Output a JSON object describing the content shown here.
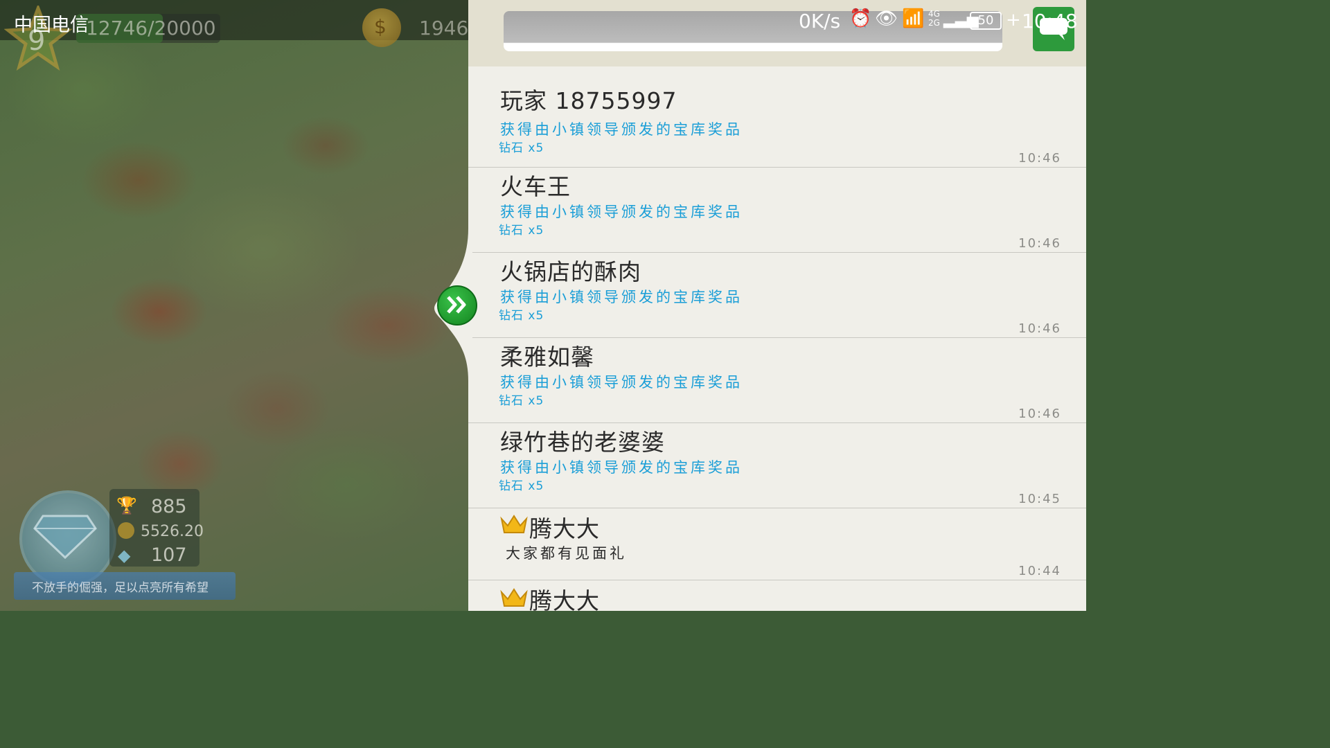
{
  "statusbar": {
    "carrier": "中国电信",
    "speed": "0K/s",
    "network": "4G 2G",
    "battery": "50",
    "time": "10:48"
  },
  "game": {
    "level": "9",
    "xp": "12746/20000",
    "coins_partial": "1946",
    "stats": {
      "trophies": "885",
      "gold": "5526.20",
      "gems": "107"
    },
    "ribbon_text": "不放手的倔强，足以点亮所有希望"
  },
  "feed": [
    {
      "name": "玩家 18755997",
      "desc": "获得由小镇领导颁发的宝库奖品",
      "reward": "钻石 x5",
      "time": "10:46"
    },
    {
      "name": "火车王",
      "desc": "获得由小镇领导颁发的宝库奖品",
      "reward": "钻石 x5",
      "time": "10:46"
    },
    {
      "name": "火锅店的酥肉",
      "desc": "获得由小镇领导颁发的宝库奖品",
      "reward": "钻石 x5",
      "time": "10:46"
    },
    {
      "name": "柔雅如馨",
      "desc": "获得由小镇领导颁发的宝库奖品",
      "reward": "钻石 x5",
      "time": "10:46"
    },
    {
      "name": "绿竹巷的老婆婆",
      "desc": "获得由小镇领导颁发的宝库奖品",
      "reward": "钻石 x5",
      "time": "10:45"
    },
    {
      "name": "腾大大",
      "desc": "大家都有见面礼",
      "time": "10:44"
    },
    {
      "name": "腾大大"
    }
  ],
  "colors": {
    "panel_bg": "#f0efe9",
    "link_blue": "#1a9ed7",
    "green_button": "#2d9a3c"
  }
}
